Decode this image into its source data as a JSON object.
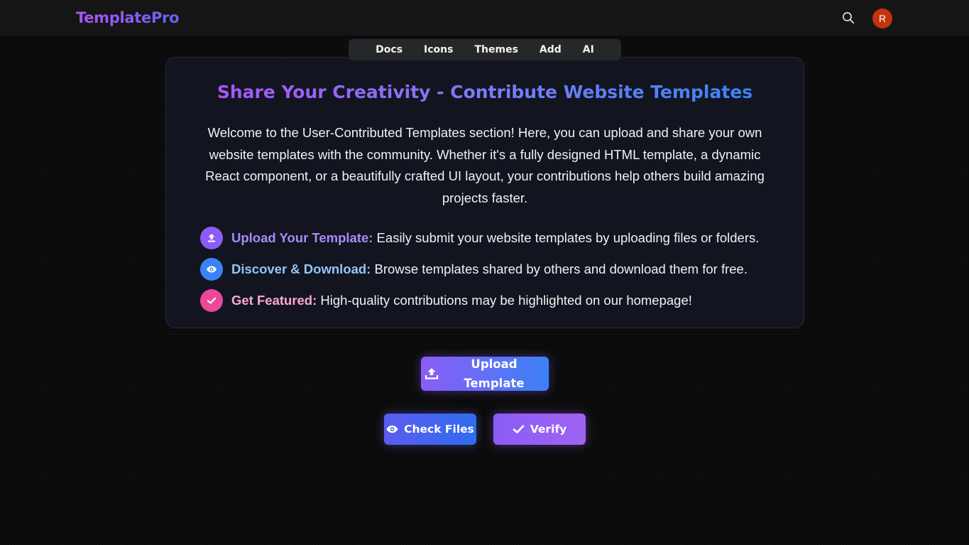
{
  "header": {
    "logo": "TemplatePro",
    "avatar_initial": "R"
  },
  "nav": {
    "items": [
      "Docs",
      "Icons",
      "Themes",
      "Add",
      "AI"
    ]
  },
  "card": {
    "title": "Share Your Creativity - Contribute Website Templates",
    "intro": "Welcome to the User-Contributed Templates section! Here, you can upload and share your own website templates with the community. Whether it's a fully designed HTML template, a dynamic React component, or a beautifully crafted UI layout, your contributions help others build amazing projects faster.",
    "features": [
      {
        "label": "Upload Your Template:",
        "text": " Easily submit your website templates by uploading files or folders.",
        "icon": "upload-icon",
        "color": "#8b5cf6",
        "label_color": "#a78bfa"
      },
      {
        "label": "Discover & Download:",
        "text": " Browse templates shared by others and download them for free.",
        "icon": "eye-icon",
        "color": "#3b82f6",
        "label_color": "#93c5fd"
      },
      {
        "label": "Get Featured:",
        "text": " High-quality contributions may be highlighted on our homepage!",
        "icon": "check-icon",
        "color": "#ec4899",
        "label_color": "#f9a8d4"
      }
    ]
  },
  "actions": {
    "upload_label": "Upload Template",
    "check_label": "Check Files",
    "verify_label": "Verify"
  },
  "colors": {
    "brand_purple": "#8b5cf6",
    "brand_blue": "#3b82f6",
    "avatar_bg": "#c2340f",
    "card_bg": "#12151f"
  }
}
